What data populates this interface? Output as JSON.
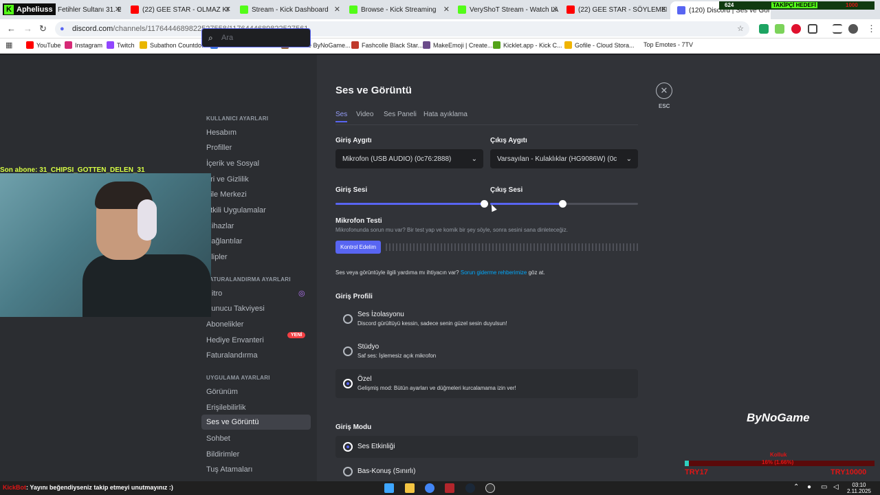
{
  "browser": {
    "tabs": [
      {
        "label": "Fetihler Sultanı 31. Bö"
      },
      {
        "label": "(22) GEE STAR - OLMAZ KI - Yo"
      },
      {
        "label": "Stream - Kick Dashboard"
      },
      {
        "label": "Browse - Kick Streaming"
      },
      {
        "label": "VeryShoT Stream - Watch Live"
      },
      {
        "label": "(22) GEE STAR - SÖYLEMEDİK"
      },
      {
        "label": "(120) Discord | Ses ve Gör"
      }
    ],
    "url_host": "discord.com",
    "url_path": "/channels/1176444689822527558/1176444689822527561",
    "bookmarks": [
      "YouTube",
      "Instagram",
      "Twitch",
      "Subathon Countdo...",
      "florescent VALORA...",
      "Donate ByNoGame...",
      "Fashcolle Black Star...",
      "MakeEmoji | Create...",
      "Kicklet.app - Kick C...",
      "Gofile - Cloud Stora...",
      "Top Emotes - 7TV"
    ]
  },
  "sidebar": {
    "search_placeholder": "Ara",
    "user_header": "KULLANICI AYARLARI",
    "user_items": [
      "Hesabım",
      "Profiller",
      "İçerik ve Sosyal",
      "eri ve Gizlilik",
      "aile Merkezi",
      "etkili Uygulamalar",
      "Cihazlar",
      "Bağlantılar",
      "Klipler"
    ],
    "billing_header": "FATURALANDIRMA AYARLARI",
    "billing_items": [
      "Nitro",
      "Sunucu Takviyesi",
      "Abonelikler",
      "Hediye Envanteri",
      "Faturalandırma"
    ],
    "app_header": "UYGULAMA AYARLARI",
    "app_items": [
      "Görünüm",
      "Erişilebilirlik",
      "Ses ve Görüntü",
      "Sohbet",
      "Bildirimler",
      "Tuş Atamaları"
    ],
    "new_badge": "YENİ"
  },
  "main": {
    "title": "Ses ve Görüntü",
    "tabs": [
      "Ses",
      "Video",
      "Ses Paneli",
      "Hata ayıklama"
    ],
    "input_device_label": "Giriş Aygıtı",
    "input_device_value": "Mikrofon (USB AUDIO) (0c76:2888)",
    "output_device_label": "Çıkış Aygıtı",
    "output_device_value": "Varsayılan - Kulaklıklar (HG9086W) (0c",
    "input_volume_label": "Giriş Sesi",
    "input_volume": 0.49,
    "output_volume_label": "Çıkış Sesi",
    "output_volume": 0.49,
    "mic_test_label": "Mikrofon Testi",
    "mic_test_desc": "Mikrofonunda sorun mu var? Bir test yap ve komik bir şey söyle, sonra sesini sana dinleteceğiz.",
    "mic_test_button": "Kontrol Edelim",
    "help_text": "Ses veya görüntüyle ilgili yardıma mı ihtiyacın var?",
    "help_link": "Sorun giderme rehberimize",
    "help_suffix": "göz at.",
    "input_profile_label": "Giriş Profili",
    "profiles": [
      {
        "title": "Ses İzolasyonu",
        "desc": "Discord gürültüyü kessin, sadece senin güzel sesin duyulsun!"
      },
      {
        "title": "Stüdyo",
        "desc": "Saf ses: İşlemesiz açık mikrofon"
      },
      {
        "title": "Özel",
        "desc": "Gelişmiş mod: Bütün ayarları ve düğmeleri kurcalamama izin ver!"
      }
    ],
    "input_mode_label": "Giriş Modu",
    "modes": [
      "Ses Etkinliği",
      "Bas-Konuş (Sınırlı)"
    ],
    "esc": "ESC"
  },
  "stream": {
    "brand": "Apheliuss",
    "last_sub": "Son abone: 31_CHIPSI_GOTTEN_DELEN_31",
    "follower_goal": "TAKİPÇİ HEDEFİ",
    "follower_now": "624",
    "follower_target": "1000",
    "ticker_bot": "KickBot",
    "ticker": ": Yayını beğendiyseniz takip etmeyi unutmayınız :)",
    "watermark": "ByNoGame",
    "try_left": "TRY17",
    "try_right": "TRY10000",
    "goal_label": "Kolluk",
    "goal_value": "16% (1.66%)"
  },
  "taskbar": {
    "time": "03:10",
    "date": "2.11.2025"
  }
}
